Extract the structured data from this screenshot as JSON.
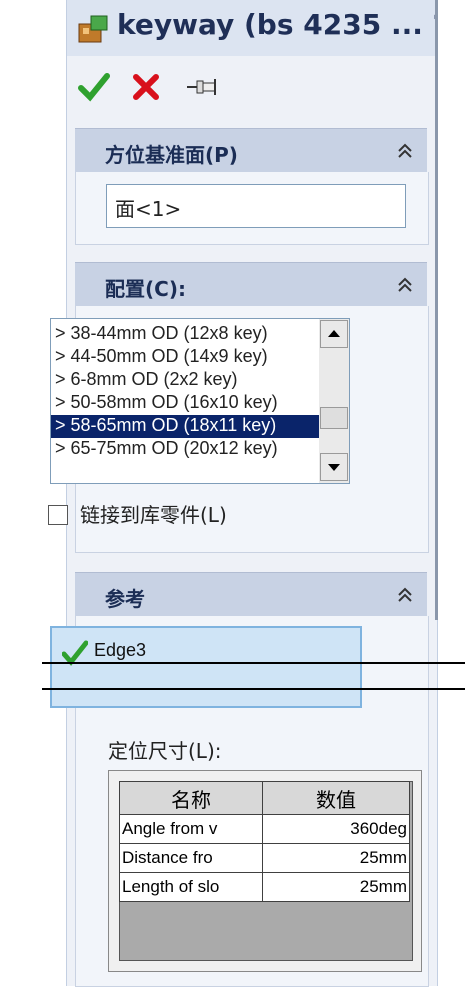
{
  "title": "keyway (bs 4235 ... ?",
  "toolbar": {
    "ok_icon": "check-icon",
    "cancel_icon": "x-icon",
    "pin_icon": "pushpin-icon"
  },
  "sections": {
    "datum": {
      "label": "方位基准面(P)",
      "value": "面<1>"
    },
    "config": {
      "label": "配置(C):",
      "items": [
        "> 38-44mm OD (12x8 key)",
        "> 44-50mm OD (14x9 key)",
        "> 6-8mm OD (2x2 key)",
        "> 50-58mm OD (16x10 key)",
        "> 58-65mm OD (18x11 key)",
        "> 65-75mm OD (20x12 key)"
      ],
      "selected_index": 4,
      "checkbox_label": "链接到库零件(L)"
    },
    "reference": {
      "label": "参考",
      "item": "Edge3"
    }
  },
  "dimension": {
    "label": "定位尺寸(L):",
    "headers": [
      "名称",
      "数值"
    ],
    "rows": [
      [
        "Angle from v",
        "360deg"
      ],
      [
        "Distance fro",
        "25mm"
      ],
      [
        "Length of slo",
        "25mm"
      ]
    ]
  },
  "colors": {
    "panel_bg": "#eef1f7",
    "header_bg": "#c8d2e4",
    "selected_bg": "#0a246a",
    "ok_green": "#2fa12f",
    "cancel_red": "#d8101c"
  }
}
